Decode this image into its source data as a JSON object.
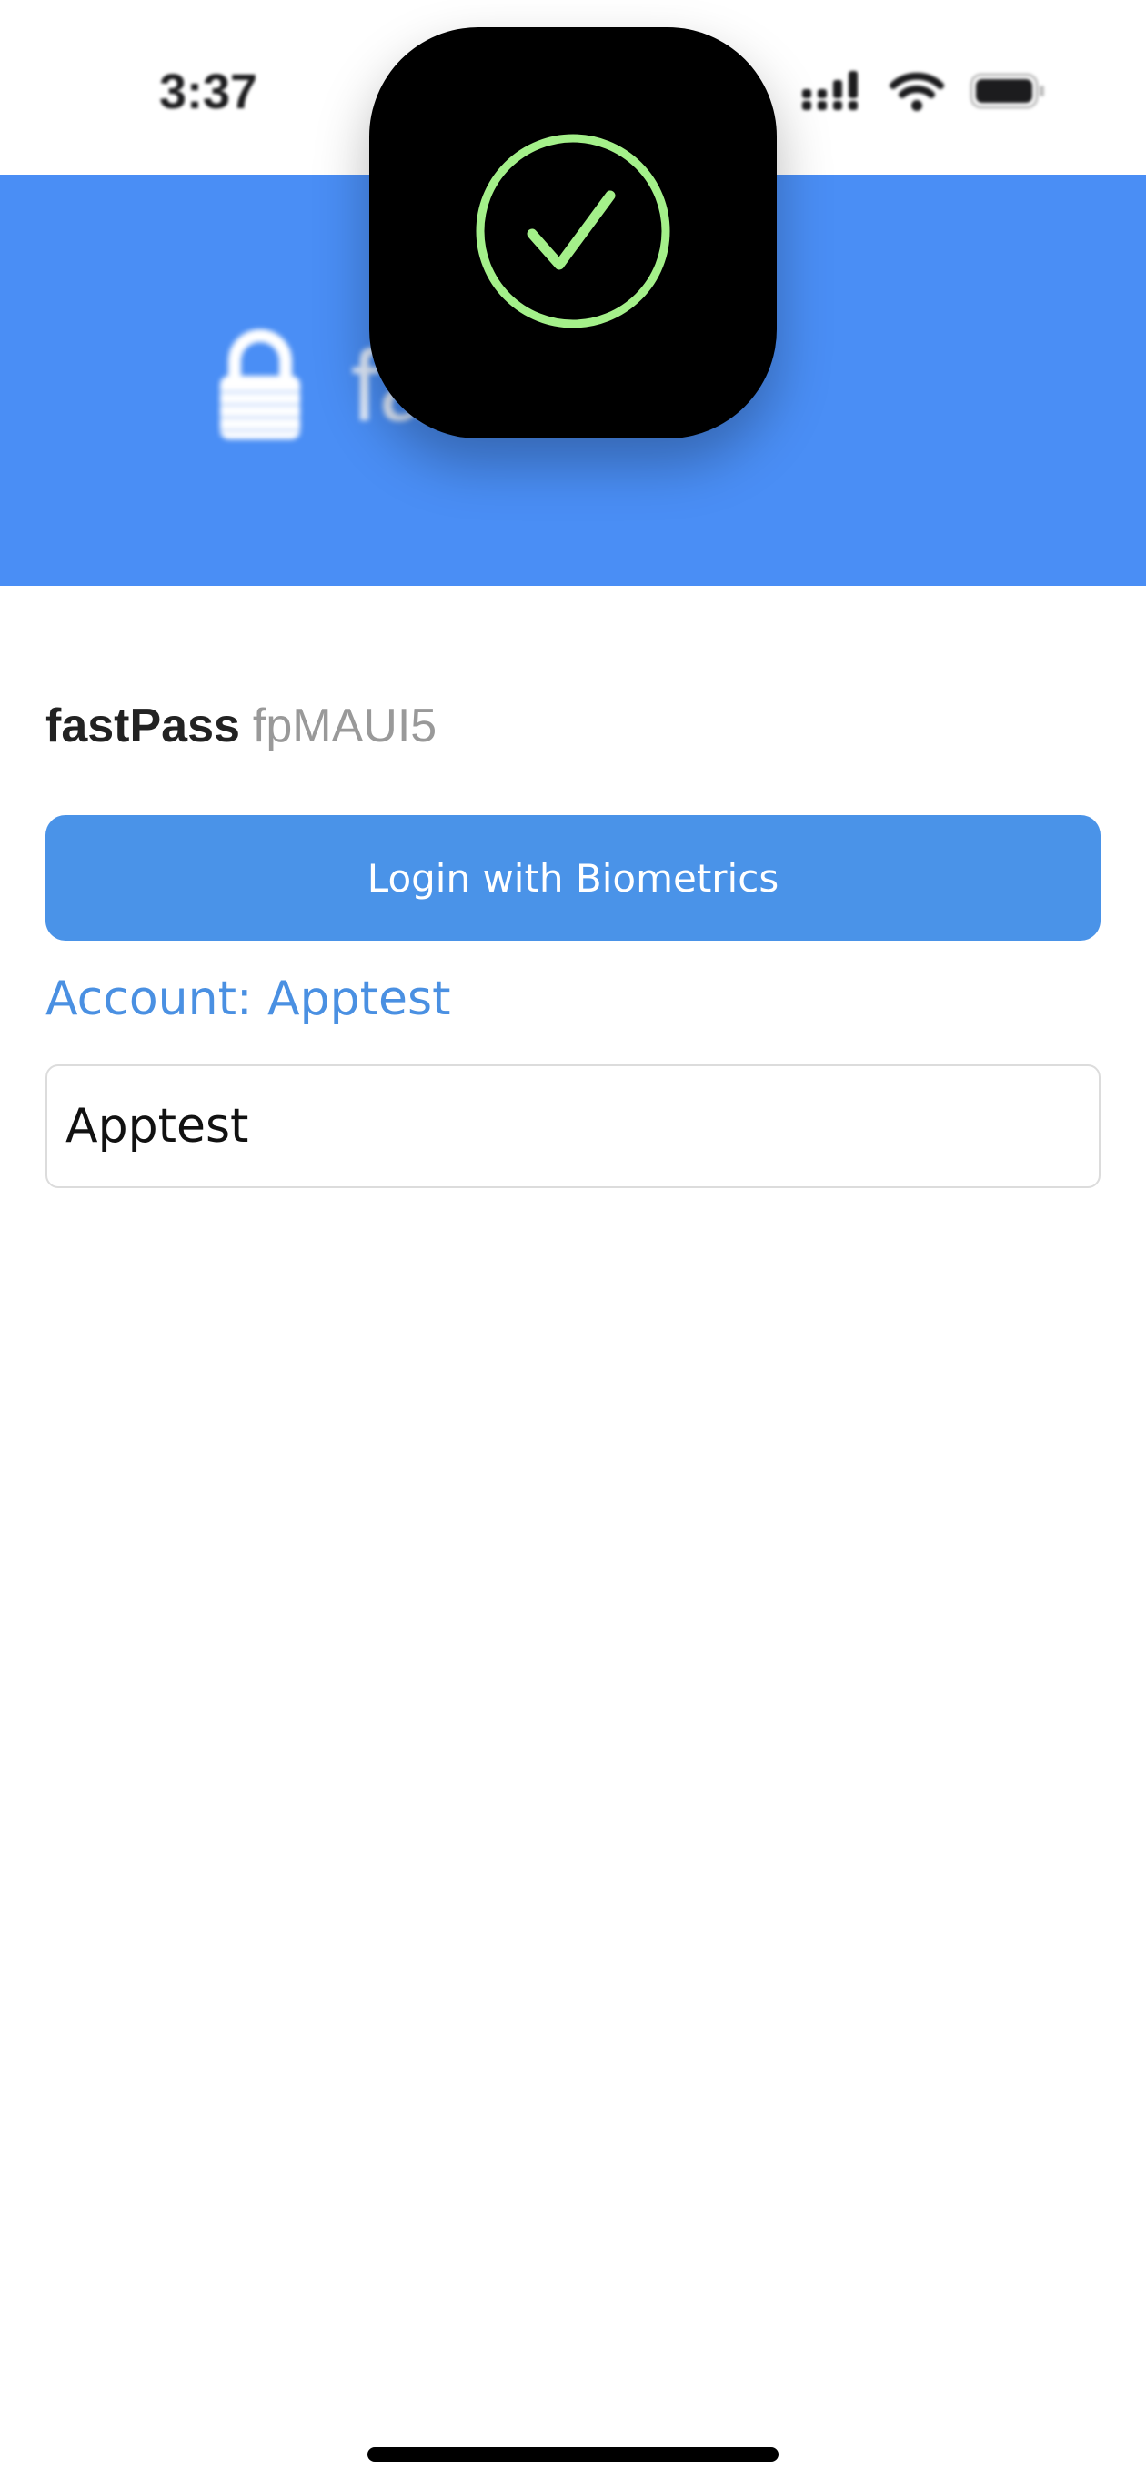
{
  "status_bar": {
    "time": "3:37",
    "icons": [
      "cellular-signal-icon",
      "wifi-icon",
      "battery-icon"
    ]
  },
  "header": {
    "title": "fa",
    "icon": "lock-icon",
    "background_color": "#4a8ef5"
  },
  "app": {
    "name": "fastPass",
    "version": "fpMAUI5"
  },
  "login_button": {
    "label": "Login with Biometrics",
    "color": "#4a93e8"
  },
  "account": {
    "label": "Account: Apptest",
    "input_value": "Apptest",
    "label_color": "#4a90e2"
  },
  "hud": {
    "icon": "checkmark-circle-icon",
    "accent_color": "#a4f08a"
  }
}
